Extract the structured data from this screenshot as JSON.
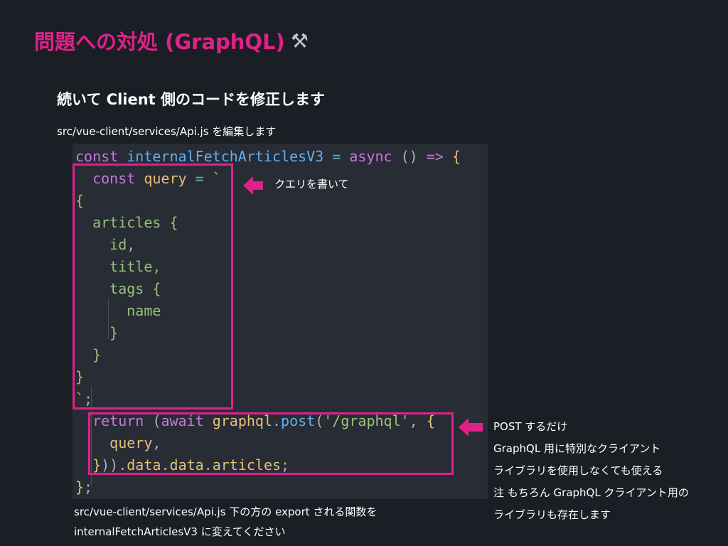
{
  "slide": {
    "title": "問題への対処 (GraphQL)",
    "title_icon": "hammer-icon",
    "subtitle": "続いて Client 側のコードを修正します",
    "file_note": "src/vue-client/services/Api.js を編集します",
    "accent_color": "#e0218a"
  },
  "code": {
    "language": "javascript",
    "lines": [
      [
        {
          "t": "const ",
          "c": "kw"
        },
        {
          "t": "internalFetchArticlesV3",
          "c": "fn"
        },
        {
          "t": " = ",
          "c": "op"
        },
        {
          "t": "async",
          "c": "kw"
        },
        {
          "t": " () ",
          "c": "pl"
        },
        {
          "t": "=>",
          "c": "kw"
        },
        {
          "t": " {",
          "c": "br"
        }
      ],
      [
        {
          "t": "  "
        },
        {
          "t": "const ",
          "c": "kw"
        },
        {
          "t": "query",
          "c": "var"
        },
        {
          "t": " = ",
          "c": "op"
        },
        {
          "t": "`",
          "c": "str"
        }
      ],
      [
        {
          "t": "{",
          "c": "str"
        }
      ],
      [
        {
          "t": "  articles {",
          "c": "str"
        }
      ],
      [
        {
          "t": "    id,",
          "c": "str"
        }
      ],
      [
        {
          "t": "    title,",
          "c": "str"
        }
      ],
      [
        {
          "t": "    tags {",
          "c": "str"
        }
      ],
      [
        {
          "t": "      name",
          "c": "str"
        }
      ],
      [
        {
          "t": "    }",
          "c": "str"
        }
      ],
      [
        {
          "t": "  }",
          "c": "str"
        }
      ],
      [
        {
          "t": "}",
          "c": "str"
        }
      ],
      [
        {
          "t": "`",
          "c": "str"
        },
        {
          "t": ";",
          "c": "pl"
        }
      ],
      [
        {
          "t": "  "
        },
        {
          "t": "return",
          "c": "kw"
        },
        {
          "t": " (",
          "c": "pl"
        },
        {
          "t": "await",
          "c": "kw"
        },
        {
          "t": " graphql",
          "c": "var"
        },
        {
          "t": ".",
          "c": "pl"
        },
        {
          "t": "post",
          "c": "fn"
        },
        {
          "t": "(",
          "c": "pl"
        },
        {
          "t": "'/graphql'",
          "c": "str"
        },
        {
          "t": ", ",
          "c": "pl"
        },
        {
          "t": "{",
          "c": "br"
        }
      ],
      [
        {
          "t": "    "
        },
        {
          "t": "query",
          "c": "var"
        },
        {
          "t": ",",
          "c": "pl"
        }
      ],
      [
        {
          "t": "  "
        },
        {
          "t": "}",
          "c": "br"
        },
        {
          "t": ")).",
          "c": "pl"
        },
        {
          "t": "data",
          "c": "var"
        },
        {
          "t": ".",
          "c": "pl"
        },
        {
          "t": "data",
          "c": "var"
        },
        {
          "t": ".",
          "c": "pl"
        },
        {
          "t": "articles",
          "c": "var"
        },
        {
          "t": ";",
          "c": "pl"
        }
      ],
      [
        {
          "t": "}",
          "c": "br"
        },
        {
          "t": ";",
          "c": "pl"
        }
      ]
    ]
  },
  "annotations": {
    "query_note": "クエリを書いて",
    "post_note_lines": [
      "POST するだけ",
      "GraphQL 用に特別なクライアント",
      "ライブラリを使用しなくても使える",
      "注 もちろん GraphQL クライアント用の",
      "ライブラリも存在します"
    ],
    "arrow_icon": "left-arrow-icon"
  },
  "footer": {
    "line1": "src/vue-client/services/Api.js 下の方の export される関数を",
    "line2": "internalFetchArticlesV3 に変えてください"
  }
}
